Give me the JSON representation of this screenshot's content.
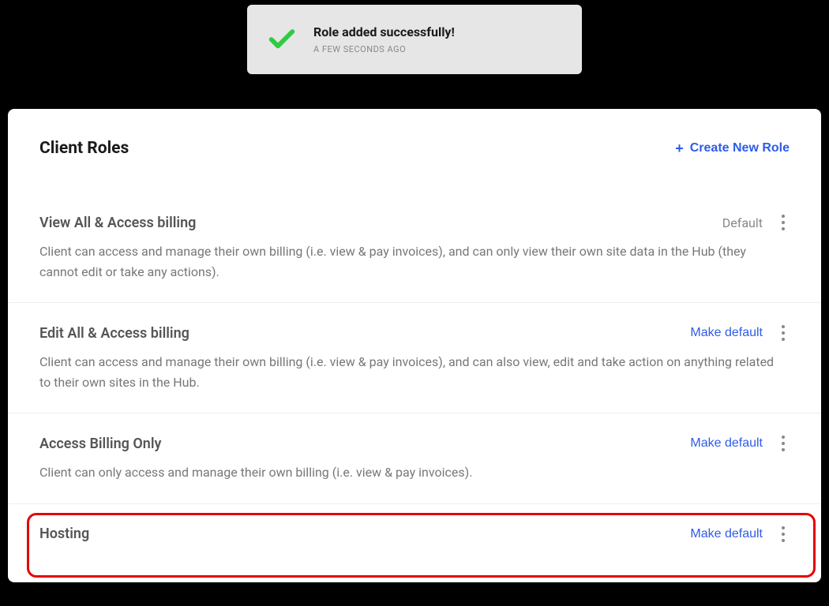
{
  "toast": {
    "title": "Role added successfully!",
    "time": "A FEW SECONDS AGO"
  },
  "panel": {
    "title": "Client Roles",
    "create_label": "Create New Role"
  },
  "labels": {
    "default": "Default",
    "make_default": "Make default"
  },
  "roles": [
    {
      "name": "View All & Access billing",
      "desc": "Client can access and manage their own billing (i.e. view & pay invoices), and can only view their own site data in the Hub (they cannot edit or take any actions).",
      "is_default": true
    },
    {
      "name": "Edit All & Access billing",
      "desc": "Client can access and manage their own billing (i.e. view & pay invoices), and can also view, edit and take action on anything related to their own sites in the Hub.",
      "is_default": false
    },
    {
      "name": "Access Billing Only",
      "desc": "Client can only access and manage their own billing (i.e. view & pay invoices).",
      "is_default": false
    },
    {
      "name": "Hosting",
      "desc": "",
      "is_default": false
    }
  ]
}
